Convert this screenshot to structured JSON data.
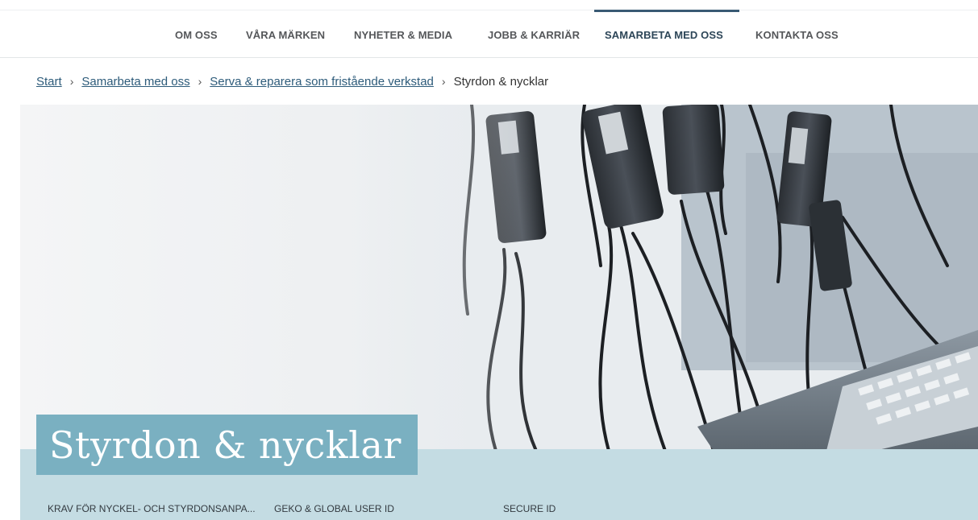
{
  "nav": {
    "items": [
      {
        "label": "OM OSS"
      },
      {
        "label": "VÅRA MÄRKEN"
      },
      {
        "label": "NYHETER & MEDIA"
      },
      {
        "label": "JOBB & KARRIÄR"
      },
      {
        "label": "SAMARBETA MED OSS",
        "active": true
      },
      {
        "label": "KONTAKTA OSS"
      }
    ]
  },
  "breadcrumb": {
    "items": [
      {
        "label": "Start"
      },
      {
        "label": "Samarbeta med oss"
      },
      {
        "label": "Serva & reparera som fristående verkstad"
      }
    ],
    "current": "Styrdon & nycklar",
    "separator": "›"
  },
  "hero": {
    "title": "Styrdon & nycklar"
  },
  "subnav": {
    "items": [
      {
        "label": "KRAV FÖR NYCKEL- OCH STYRDONSANPA..."
      },
      {
        "label": "GEKO & GLOBAL USER ID"
      },
      {
        "label": "SECURE ID"
      }
    ]
  },
  "colors": {
    "nav_active": "#395a74",
    "link": "#2d5b7a",
    "title_box": "#7ab0c1",
    "band": "#c4dce3"
  }
}
